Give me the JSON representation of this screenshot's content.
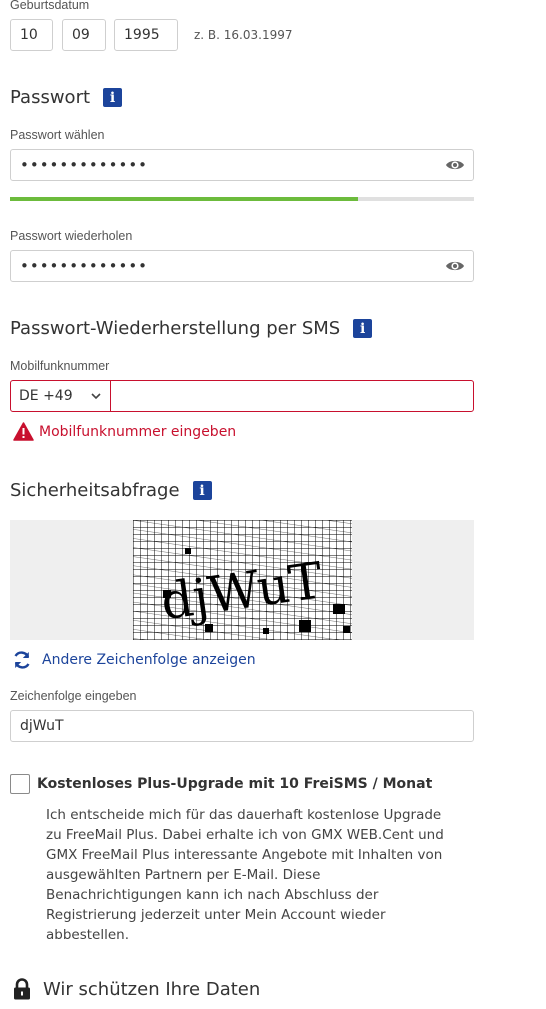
{
  "birthdate": {
    "label": "Geburtsdatum",
    "day": "10",
    "month": "09",
    "year": "1995",
    "hint": "z. B. 16.03.1997"
  },
  "password": {
    "heading": "Passwort",
    "info_icon": "info-icon",
    "choose_label": "Passwort wählen",
    "choose_value": "•••••••••••••",
    "strength_fraction": 0.75,
    "strength_color": "#6cbb3c",
    "repeat_label": "Passwort wiederholen",
    "repeat_value": "•••••••••••••",
    "toggle_icon": "eye-icon"
  },
  "sms_recovery": {
    "heading": "Passwort-Wiederherstellung per SMS",
    "phone_label": "Mobilfunknummer",
    "country_code": "DE +49",
    "phone_value": "",
    "error_text": "Mobilfunknummer eingeben",
    "error_color": "#c8102e",
    "error_icon": "warning-icon"
  },
  "captcha": {
    "heading": "Sicherheitsabfrage",
    "image_text": "djWuT",
    "refresh_icon": "refresh-icon",
    "refresh_label": "Andere Zeichenfolge anzeigen",
    "input_label": "Zeichenfolge eingeben",
    "input_value": "djWuT"
  },
  "upgrade": {
    "checked": false,
    "label": "Kostenloses Plus-Upgrade mit 10 FreiSMS / Monat",
    "description_lines": [
      "Ich entscheide mich für das dauerhaft kostenlose Upgrade",
      "zu FreeMail Plus. Dabei erhalte ich von GMX WEB.Cent und",
      "GMX FreeMail Plus interessante Angebote mit Inhalten von",
      "ausgewählten Partnern per E-Mail. Diese",
      "Benachrichtigungen kann ich nach Abschluss der",
      "Registrierung jederzeit unter Mein Account wieder",
      "abbestellen."
    ]
  },
  "privacy": {
    "icon": "lock-icon",
    "heading": "Wir schützen Ihre Daten"
  },
  "colors": {
    "brand_blue": "#1c449b",
    "link_blue": "#1c449b"
  }
}
